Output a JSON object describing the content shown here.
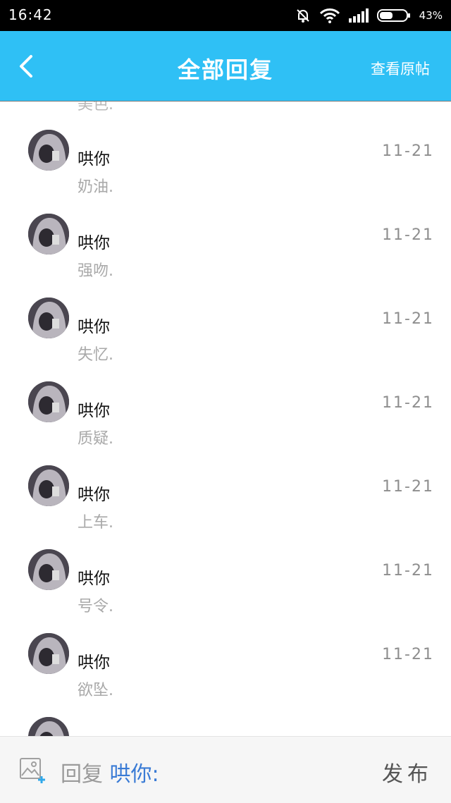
{
  "status_bar": {
    "time": "16:42",
    "battery": "43%"
  },
  "header": {
    "title": "全部回复",
    "view_original": "查看原帖"
  },
  "partial_top_text": "美色.",
  "replies": [
    {
      "name": "哄你",
      "text": "奶油.",
      "date": "11-21"
    },
    {
      "name": "哄你",
      "text": "强吻.",
      "date": "11-21"
    },
    {
      "name": "哄你",
      "text": "失忆.",
      "date": "11-21"
    },
    {
      "name": "哄你",
      "text": "质疑.",
      "date": "11-21"
    },
    {
      "name": "哄你",
      "text": "上车.",
      "date": "11-21"
    },
    {
      "name": "哄你",
      "text": "号令.",
      "date": "11-21"
    },
    {
      "name": "哄你",
      "text": "欲坠.",
      "date": "11-21"
    }
  ],
  "composer": {
    "reply_prefix": "回复",
    "reply_target": "哄你:",
    "publish": "发布"
  },
  "colors": {
    "accent": "#2fc0f5",
    "link": "#3a7bd5"
  },
  "icons": [
    "back-arrow-icon",
    "silent-bell-icon",
    "wifi-icon",
    "signal-icon",
    "battery-icon",
    "add-image-icon"
  ]
}
